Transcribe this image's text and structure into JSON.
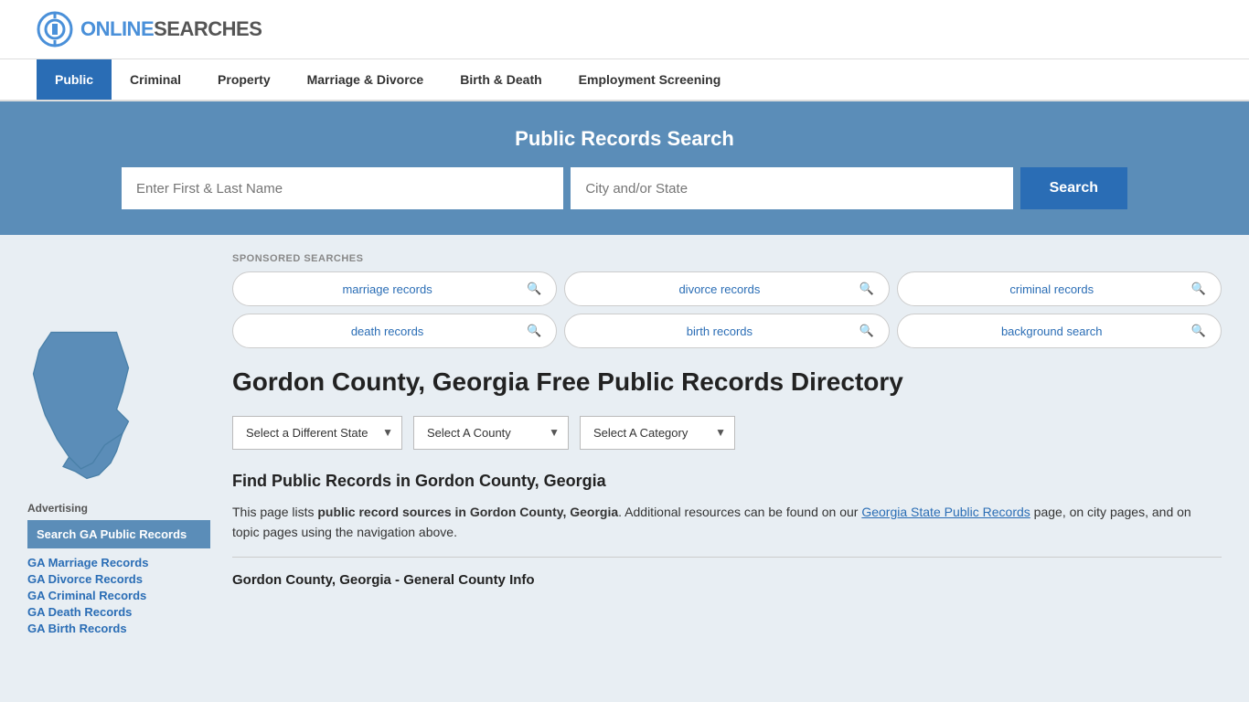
{
  "logo": {
    "online": "ONLINE",
    "searches": "SEARCHES",
    "alt": "OnlineSearches Logo"
  },
  "nav": {
    "items": [
      {
        "label": "Public",
        "active": true
      },
      {
        "label": "Criminal",
        "active": false
      },
      {
        "label": "Property",
        "active": false
      },
      {
        "label": "Marriage & Divorce",
        "active": false
      },
      {
        "label": "Birth & Death",
        "active": false
      },
      {
        "label": "Employment Screening",
        "active": false
      }
    ]
  },
  "search_banner": {
    "title": "Public Records Search",
    "name_placeholder": "Enter First & Last Name",
    "city_placeholder": "City and/or State",
    "button_label": "Search"
  },
  "sponsored": {
    "label": "SPONSORED SEARCHES",
    "pills": [
      {
        "text": "marriage records"
      },
      {
        "text": "divorce records"
      },
      {
        "text": "criminal records"
      },
      {
        "text": "death records"
      },
      {
        "text": "birth records"
      },
      {
        "text": "background search"
      }
    ]
  },
  "sidebar": {
    "advertising_label": "Advertising",
    "ad_box_text": "Search GA Public Records",
    "links": [
      "GA Marriage Records",
      "GA Divorce Records",
      "GA Criminal Records",
      "GA Death Records",
      "GA Birth Records"
    ]
  },
  "page": {
    "title": "Gordon County, Georgia Free Public Records Directory",
    "dropdowns": {
      "state": {
        "label": "Select a Different State",
        "options": [
          "Select a Different State"
        ]
      },
      "county": {
        "label": "Select A County",
        "options": [
          "Select A County"
        ]
      },
      "category": {
        "label": "Select A Category",
        "options": [
          "Select A Category"
        ]
      }
    },
    "find_title": "Find Public Records in Gordon County, Georgia",
    "find_text_1": "This page lists ",
    "find_text_bold": "public record sources in Gordon County, Georgia",
    "find_text_2": ". Additional resources can be found on our ",
    "find_link_text": "Georgia State Public Records",
    "find_text_3": " page, on city pages, and on topic pages using the navigation above.",
    "county_general_title": "Gordon County, Georgia - General County Info"
  },
  "colors": {
    "blue_primary": "#2a6db5",
    "blue_banner": "#5b8db8",
    "nav_active": "#2a6db5"
  }
}
